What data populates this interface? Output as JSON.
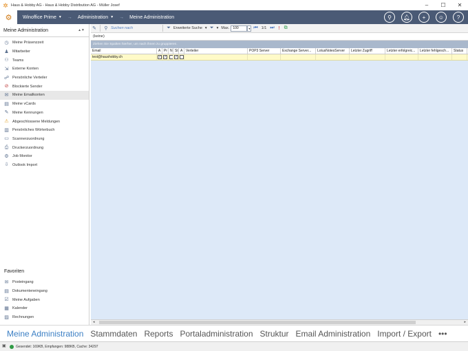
{
  "window": {
    "title": "Haus & Hobby AG - Haus & Hobby Distribution AG - Müller Josef"
  },
  "nav": {
    "app": "Winoffice Prime",
    "section": "Administration",
    "page": "Meine Administration"
  },
  "sidebar": {
    "header": "Meine Administration",
    "items": [
      {
        "label": "Meine Präsenzzeit",
        "icon": "clock-icon"
      },
      {
        "label": "Mitarbeiter",
        "icon": "person-icon"
      },
      {
        "label": "Teams",
        "icon": "team-icon"
      },
      {
        "label": "Externe Konten",
        "icon": "external-account-icon"
      },
      {
        "label": "Persönliche Verteiler",
        "icon": "distributor-icon"
      },
      {
        "label": "Blockierte Sender",
        "icon": "blocked-sender-icon"
      },
      {
        "label": "Meine Emailkonten",
        "icon": "email-account-icon"
      },
      {
        "label": "Meine vCards",
        "icon": "vcard-icon"
      },
      {
        "label": "Meine Kennungen",
        "icon": "identifier-icon"
      },
      {
        "label": "Abgeschlossene Meldungen",
        "icon": "warning-icon"
      },
      {
        "label": "Persönliches Wörterbuch",
        "icon": "dictionary-icon"
      },
      {
        "label": "Scannerzuordnung",
        "icon": "scanner-icon"
      },
      {
        "label": "Druckerzuordnung",
        "icon": "printer-icon"
      },
      {
        "label": "Job Monitor",
        "icon": "gear-icon"
      },
      {
        "label": "Outlook Import",
        "icon": "import-icon"
      }
    ],
    "favorites_title": "Favoriten",
    "favorites": [
      {
        "label": "Posteingang",
        "icon": "inbox-icon"
      },
      {
        "label": "Dokumenteneingang",
        "icon": "document-inbox-icon"
      },
      {
        "label": "Meine Aufgaben",
        "icon": "tasks-icon"
      },
      {
        "label": "Kalender",
        "icon": "calendar-icon"
      },
      {
        "label": "Rechnungen",
        "icon": "invoice-icon"
      }
    ]
  },
  "toolbar": {
    "search_placeholder": "Suchen nach",
    "extended_search": "Erweiterte Suche",
    "max_label": "Max.",
    "max_value": "100",
    "page": "1/1"
  },
  "grid": {
    "filter": "(keine)",
    "group_hint": "Ziehen Sie Spalten hierher, um nach ihnen zu gruppieren.",
    "columns": [
      "Email",
      "A",
      "Pr",
      "N",
      "St",
      "A",
      "Verteiler",
      "POP3 Server",
      "Exchange Server...",
      "LotusNotesServer",
      "Letzter Zugriff",
      "Letzter erfolgreic...",
      "Letzter fehlgesch...",
      "Status"
    ],
    "rows": [
      {
        "email": "test@haushobby.ch",
        "a": true,
        "pr": true,
        "n": false,
        "st": true,
        "a2": false
      }
    ]
  },
  "tabs": [
    {
      "label": "Meine Administration",
      "active": true
    },
    {
      "label": "Stammdaten"
    },
    {
      "label": "Reports"
    },
    {
      "label": "Portaladministration"
    },
    {
      "label": "Struktur"
    },
    {
      "label": "Email Administration"
    },
    {
      "label": "Import / Export"
    },
    {
      "label": "•••"
    }
  ],
  "status": {
    "text": "Gesendet: 169KB, Empfangen: 988KB, Cache: 34297"
  },
  "colors": {
    "nav_bg": "#4a5a75",
    "grid_bg": "#dde9f8",
    "row_highlight": "#fffac8",
    "active_tab": "#3b7fc4"
  }
}
